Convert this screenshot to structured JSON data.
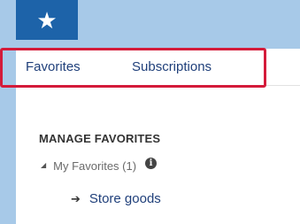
{
  "favorites_button": {
    "icon": "star-icon",
    "glyph": "★"
  },
  "tabs": [
    {
      "label": "Favorites"
    },
    {
      "label": "Subscriptions"
    }
  ],
  "highlight_color": "#d41b3a",
  "manage": {
    "title": "MANAGE FAVORITES",
    "tree": {
      "root_label": "My Favorites (1)",
      "info_glyph": "i",
      "toggle_glyph": "◢",
      "children": [
        {
          "arrow": "➔",
          "label": "Store goods"
        }
      ]
    }
  }
}
